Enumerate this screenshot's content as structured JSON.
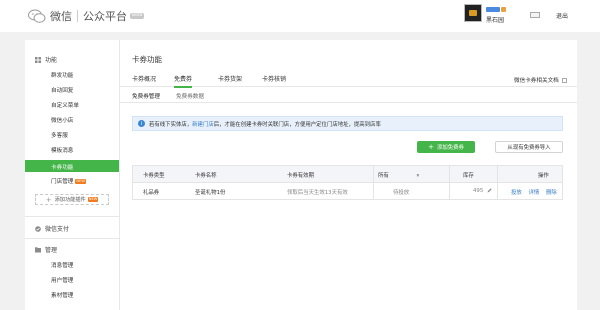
{
  "header": {
    "brand_name": "微信",
    "platform_name": "公众平台",
    "beta": "Beta",
    "user_name": "黑石园",
    "logout": "退出"
  },
  "sidebar": {
    "features_heading": "功能",
    "items": [
      {
        "label": "群发功能"
      },
      {
        "label": "自动回复"
      },
      {
        "label": "自定义菜单"
      },
      {
        "label": "微信小店"
      },
      {
        "label": "多客服"
      },
      {
        "label": "模板消息"
      },
      {
        "label": "卡券功能"
      },
      {
        "label": "门店管理"
      }
    ],
    "new_tag": "NEW",
    "add_plugin": "添加功能插件",
    "payment_heading": "微信支付",
    "manage_heading": "管理",
    "manage_items": [
      {
        "label": "消息管理"
      },
      {
        "label": "用户管理"
      },
      {
        "label": "素材管理"
      }
    ]
  },
  "main": {
    "title": "卡券功能",
    "tabs": [
      {
        "label": "卡券概况"
      },
      {
        "label": "免费券"
      },
      {
        "label": "卡券货架"
      },
      {
        "label": "卡券核销"
      }
    ],
    "doc_link": "微信卡券相关文档",
    "subtabs": [
      {
        "label": "免费券管理"
      },
      {
        "label": "免费券数据"
      }
    ],
    "notice": {
      "before": "若有线下实体店，",
      "link": "新建门店",
      "after": "后，才能在创建卡券时关联门店，方便用户定位门店地址，提高到店率"
    },
    "add_button": "添加免费券",
    "import_button": "从现有免费券导入",
    "table": {
      "columns": [
        "卡券类型",
        "卡券名称",
        "卡券有效期",
        "所有",
        "库存",
        "操作"
      ],
      "rows": [
        {
          "type": "礼品券",
          "name": "圣诞礼物1份",
          "validity": "领取后当天生效13天有效",
          "status": "待投放",
          "stock": "495",
          "actions": [
            "投放",
            "详情",
            "删除"
          ]
        }
      ]
    }
  },
  "colors": {
    "accent": "#44b549",
    "link": "#3a7ec6",
    "notice_bg": "#e8f1fb"
  }
}
